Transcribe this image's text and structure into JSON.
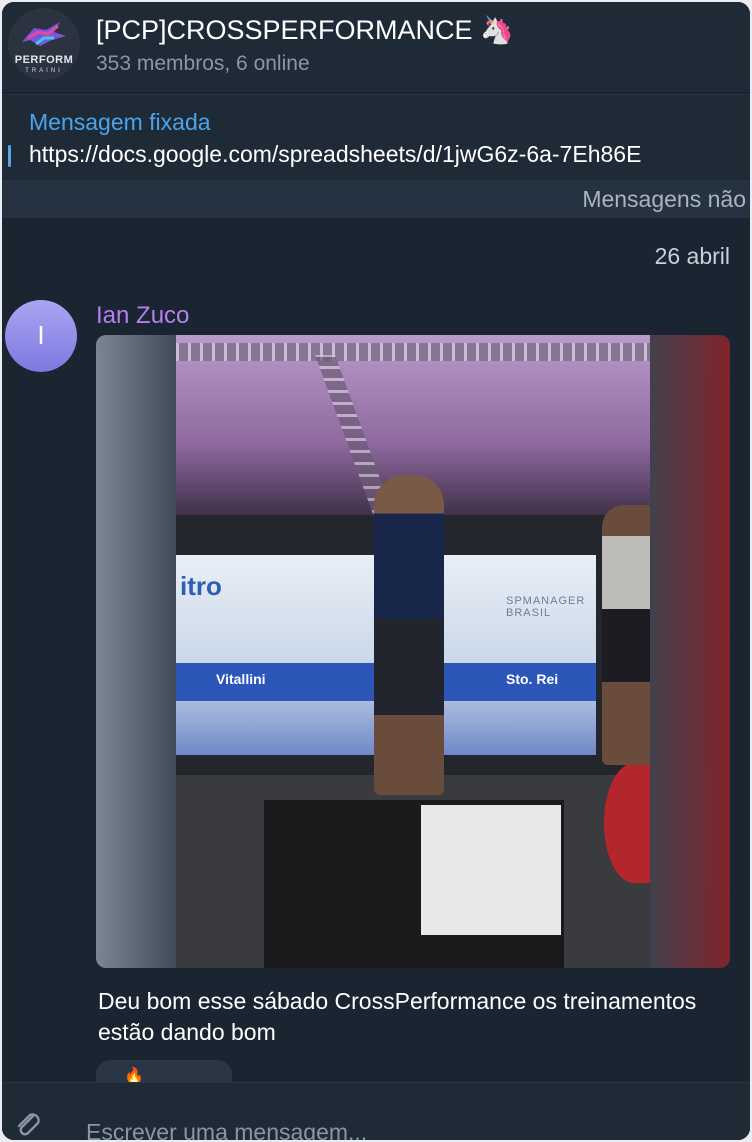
{
  "header": {
    "title": "[PCP]CROSSPERFORMANCE 🦄",
    "subtitle": "353 membros, 6 online",
    "avatar_text": "PERFORM",
    "avatar_subtext": "TRAINI"
  },
  "pinned": {
    "title": "Mensagem fixada",
    "text": "https://docs.google.com/spreadsheets/d/1jwG6z-6a-7Eh86E"
  },
  "unread_label": "Mensagens não",
  "date_separator": "26 abril",
  "message": {
    "avatar_initial": "I",
    "sender": "Ian Zuco",
    "photo_texts": {
      "brand": "itro",
      "spmanager": "SPMANAGER BRASIL",
      "sponsor1": "Vitallini",
      "sponsor2": "Sto. Rei"
    },
    "caption": "Deu bom esse sábado CrossPerformance os treinamentos estão dando bom",
    "reaction_emoji": "🔥"
  },
  "composer": {
    "placeholder": "Escrever uma mensagem..."
  },
  "colors": {
    "background": "#1b2532",
    "header": "#1f2a37",
    "link": "#4aa3ec",
    "sender": "#b57ef1"
  },
  "icons": [
    "paperclip-icon",
    "group-avatar"
  ]
}
